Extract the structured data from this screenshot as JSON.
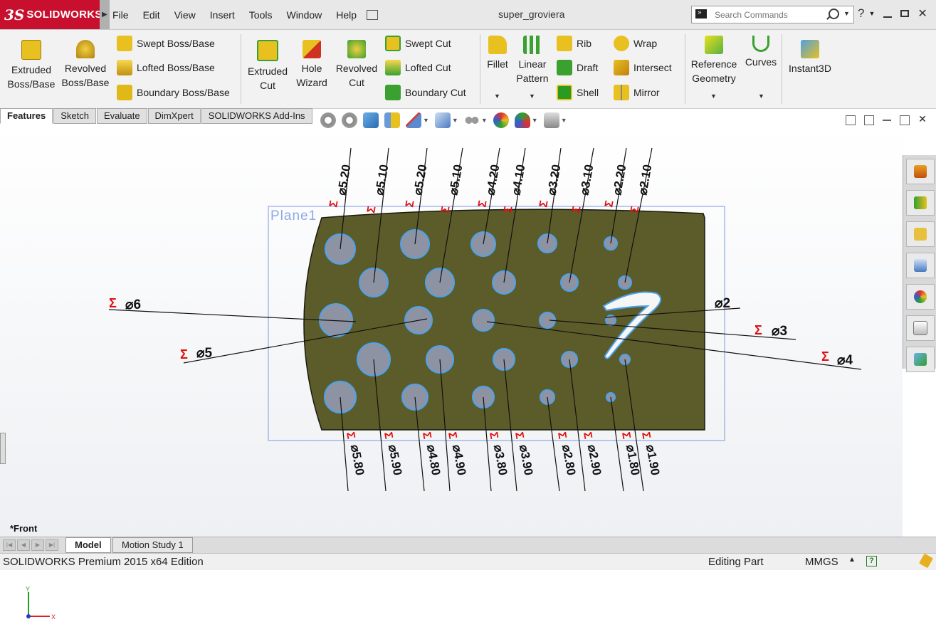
{
  "app": {
    "logo_ds": "3S",
    "logo_name": "SOLIDWORKS",
    "document_title": "super_groviera"
  },
  "menu": [
    "File",
    "Edit",
    "View",
    "Insert",
    "Tools",
    "Window",
    "Help"
  ],
  "search": {
    "placeholder": "Search Commands"
  },
  "ribbon": {
    "extruded_boss": [
      "Extruded",
      "Boss/Base"
    ],
    "revolved_boss": [
      "Revolved",
      "Boss/Base"
    ],
    "swept_boss": "Swept Boss/Base",
    "lofted_boss": "Lofted Boss/Base",
    "boundary_boss": "Boundary Boss/Base",
    "extruded_cut": [
      "Extruded",
      "Cut"
    ],
    "hole_wizard": [
      "Hole",
      "Wizard"
    ],
    "revolved_cut": [
      "Revolved",
      "Cut"
    ],
    "swept_cut": "Swept Cut",
    "lofted_cut": "Lofted Cut",
    "boundary_cut": "Boundary Cut",
    "fillet": "Fillet",
    "linear_pattern": [
      "Linear",
      "Pattern"
    ],
    "rib": "Rib",
    "draft": "Draft",
    "shell": "Shell",
    "wrap": "Wrap",
    "intersect": "Intersect",
    "mirror": "Mirror",
    "reference_geometry": [
      "Reference",
      "Geometry"
    ],
    "curves": "Curves",
    "instant3d": "Instant3D"
  },
  "tabs": [
    "Features",
    "Sketch",
    "Evaluate",
    "DimXpert",
    "SOLIDWORKS Add-Ins"
  ],
  "viewport": {
    "plane_label": "Plane1",
    "view_name": "*Front",
    "triad": {
      "x": "X",
      "y": "Y"
    },
    "sigma": "Σ",
    "top_dims": [
      "⌀5.20",
      "⌀5.10",
      "⌀5.20",
      "⌀5.10",
      "⌀4.20",
      "⌀4.10",
      "⌀3.20",
      "⌀3.10",
      "⌀2.20",
      "⌀2.10"
    ],
    "bottom_dims": [
      "⌀5.80",
      "⌀5.90",
      "⌀4.80",
      "⌀4.90",
      "⌀3.80",
      "⌀3.90",
      "⌀2.80",
      "⌀2.90",
      "⌀1.80",
      "⌀1.90"
    ],
    "side_dims": {
      "d6": "⌀6",
      "d5": "⌀5",
      "d2": "⌀2",
      "d3": "⌀3",
      "d4": "⌀4"
    },
    "colors": {
      "part": "#5c5c2b",
      "hole_edge": "#4aa3f0",
      "plane": "#8fa8e8",
      "sigma": "#e01010"
    }
  },
  "model_tabs": [
    "Model",
    "Motion Study 1"
  ],
  "status": {
    "edition": "SOLIDWORKS Premium 2015 x64 Edition",
    "mode": "Editing Part",
    "units": "MMGS"
  }
}
